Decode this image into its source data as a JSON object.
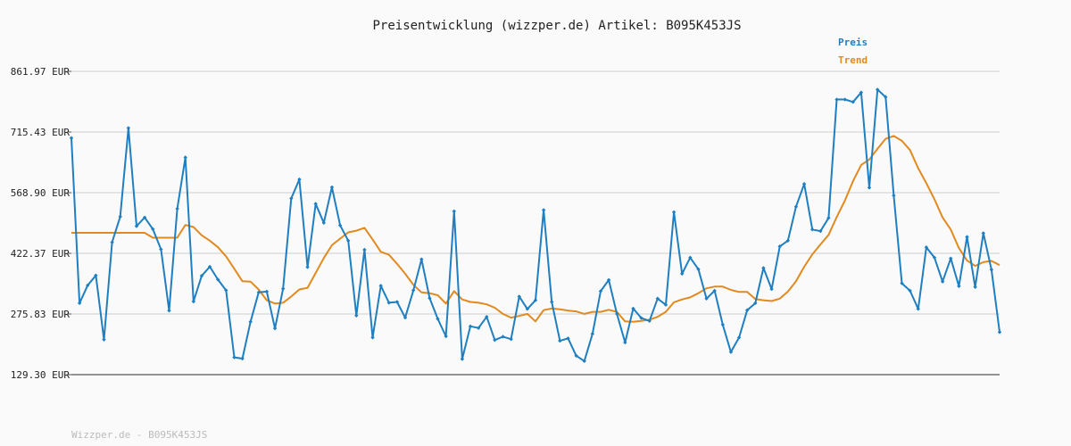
{
  "chart_data": {
    "type": "line",
    "title": "Preisentwicklung (wizzper.de) Artikel: B095K453JS",
    "ylim": [
      129.3,
      861.97
    ],
    "y_ticks": [
      "861.97 EUR",
      "715.43 EUR",
      "568.90 EUR",
      "422.37 EUR",
      "275.83 EUR",
      "129.30 EUR"
    ],
    "y_tick_values": [
      861.97,
      715.43,
      568.9,
      422.37,
      275.83,
      129.3
    ],
    "grid": true,
    "legend_position": "top-right",
    "series": [
      {
        "name": "Preis",
        "color": "#1f7fc0",
        "values": [
          701,
          302,
          345,
          369,
          214,
          449,
          511,
          725,
          488,
          509,
          481,
          432,
          284,
          530,
          654,
          306,
          368,
          390,
          359,
          333,
          171,
          168,
          257,
          328,
          330,
          241,
          337,
          555,
          601,
          389,
          542,
          496,
          582,
          490,
          453,
          272,
          431,
          219,
          344,
          303,
          305,
          267,
          333,
          408,
          314,
          264,
          222,
          524,
          167,
          246,
          242,
          269,
          213,
          221,
          215,
          318,
          288,
          309,
          527,
          305,
          211,
          217,
          175,
          162,
          228,
          331,
          358,
          276,
          207,
          289,
          266,
          259,
          313,
          298,
          522,
          373,
          412,
          384,
          313,
          332,
          250,
          184,
          219,
          285,
          302,
          387,
          336,
          439,
          453,
          535,
          590,
          480,
          476,
          508,
          794,
          794,
          788,
          811,
          581,
          818,
          800,
          562,
          350,
          332,
          288,
          437,
          412,
          354,
          410,
          343,
          462,
          341,
          471,
          383,
          232
        ]
      },
      {
        "name": "Trend",
        "color": "#e08a20",
        "values": [
          472,
          472,
          472,
          472,
          472,
          472,
          472,
          472,
          472,
          472,
          460,
          460,
          460,
          460,
          491,
          486,
          466,
          453,
          437,
          415,
          385,
          355,
          354,
          335,
          309,
          301,
          303,
          318,
          335,
          339,
          375,
          411,
          442,
          458,
          473,
          477,
          484,
          456,
          426,
          419,
          397,
          373,
          346,
          328,
          326,
          321,
          301,
          331,
          311,
          305,
          303,
          299,
          291,
          276,
          267,
          271,
          276,
          258,
          285,
          289,
          287,
          284,
          282,
          276,
          281,
          281,
          286,
          281,
          258,
          257,
          259,
          262,
          269,
          281,
          304,
          311,
          316,
          326,
          338,
          342,
          342,
          334,
          329,
          329,
          312,
          309,
          307,
          313,
          330,
          355,
          390,
          420,
          444,
          467,
          510,
          550,
          597,
          636,
          649,
          675,
          699,
          706,
          694,
          672,
          628,
          592,
          553,
          509,
          480,
          435,
          405,
          392,
          401,
          404,
          394
        ]
      }
    ]
  },
  "footer": "Wizzper.de - B095K453JS"
}
